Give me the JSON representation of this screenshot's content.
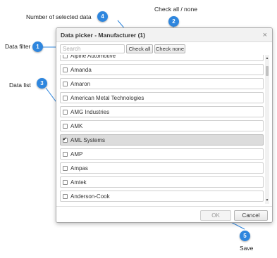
{
  "callouts": {
    "number_of_selected_data": "Number of selected data",
    "check_all_none": "Check all / none",
    "data_filter": "Data filter",
    "data_list": "Data list",
    "save": "Save"
  },
  "badges": [
    "1",
    "2",
    "3",
    "4",
    "5"
  ],
  "badge_color": "#2e86de",
  "dialog": {
    "title": "Data picker - Manufacturer (1)",
    "close_glyph": "×",
    "search_placeholder": "Search",
    "check_all_label": "Check all",
    "check_none_label": "Check none",
    "items": [
      {
        "label": "Alpine Automotive",
        "checked": false
      },
      {
        "label": "Amanda",
        "checked": false
      },
      {
        "label": "Amaron",
        "checked": false
      },
      {
        "label": "American Metal Technologies",
        "checked": false
      },
      {
        "label": "AMG Industries",
        "checked": false
      },
      {
        "label": "AMK",
        "checked": false
      },
      {
        "label": "AML Systems",
        "checked": true
      },
      {
        "label": "AMP",
        "checked": false
      },
      {
        "label": "Ampas",
        "checked": false
      },
      {
        "label": "Amtek",
        "checked": false
      },
      {
        "label": "Anderson-Cook",
        "checked": false
      }
    ],
    "ok_label": "OK",
    "cancel_label": "Cancel"
  }
}
